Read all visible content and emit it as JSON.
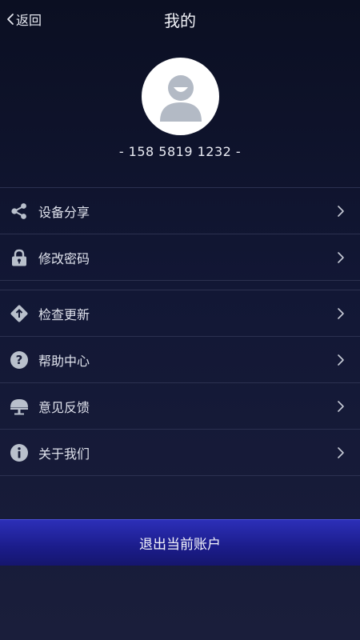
{
  "header": {
    "back_label": "返回",
    "title": "我的"
  },
  "profile": {
    "phone": "- 158 5819 1232 -"
  },
  "menu_group_1": [
    {
      "label": "设备分享",
      "icon": "share-icon"
    },
    {
      "label": "修改密码",
      "icon": "lock-icon"
    }
  ],
  "menu_group_2": [
    {
      "label": "检查更新",
      "icon": "update-icon"
    },
    {
      "label": "帮助中心",
      "icon": "help-icon"
    },
    {
      "label": "意见反馈",
      "icon": "feedback-icon"
    },
    {
      "label": "关于我们",
      "icon": "info-icon"
    }
  ],
  "logout": {
    "label": "退出当前账户"
  },
  "colors": {
    "background_top": "#0b0f22",
    "background_bottom": "#1a1e3b",
    "icon_gray": "#b9c0cc",
    "logout_button": "#2326a8"
  }
}
